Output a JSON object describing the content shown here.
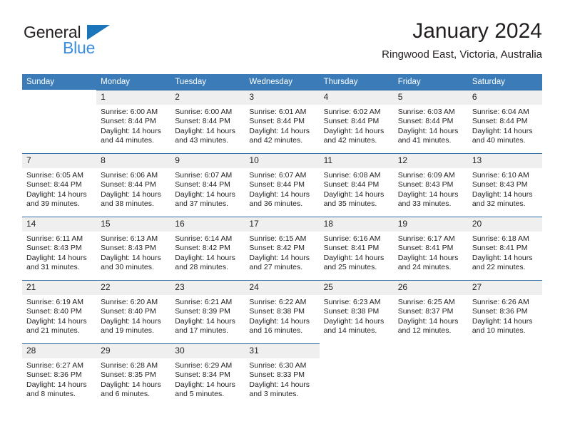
{
  "brand": {
    "name_part1": "General",
    "name_part2": "Blue",
    "triangle_icon": "triangle-icon",
    "accent_dark": "#231f20",
    "accent_blue": "#1b75bb",
    "accent_light_blue": "#3a8dde"
  },
  "header": {
    "month_title": "January 2024",
    "location": "Ringwood East, Victoria, Australia"
  },
  "theme": {
    "header_blue": "#3b7cb8",
    "rule_blue": "#2f6ea5",
    "daynum_bg": "#efefef",
    "text": "#231f20"
  },
  "calendar": {
    "weekday_headers": [
      "Sunday",
      "Monday",
      "Tuesday",
      "Wednesday",
      "Thursday",
      "Friday",
      "Saturday"
    ],
    "weeks": [
      [
        {
          "day": "",
          "empty": true,
          "sunrise": "",
          "sunset": "",
          "daylight1": "",
          "daylight2": ""
        },
        {
          "day": "1",
          "sunrise": "Sunrise: 6:00 AM",
          "sunset": "Sunset: 8:44 PM",
          "daylight1": "Daylight: 14 hours",
          "daylight2": "and 44 minutes."
        },
        {
          "day": "2",
          "sunrise": "Sunrise: 6:00 AM",
          "sunset": "Sunset: 8:44 PM",
          "daylight1": "Daylight: 14 hours",
          "daylight2": "and 43 minutes."
        },
        {
          "day": "3",
          "sunrise": "Sunrise: 6:01 AM",
          "sunset": "Sunset: 8:44 PM",
          "daylight1": "Daylight: 14 hours",
          "daylight2": "and 42 minutes."
        },
        {
          "day": "4",
          "sunrise": "Sunrise: 6:02 AM",
          "sunset": "Sunset: 8:44 PM",
          "daylight1": "Daylight: 14 hours",
          "daylight2": "and 42 minutes."
        },
        {
          "day": "5",
          "sunrise": "Sunrise: 6:03 AM",
          "sunset": "Sunset: 8:44 PM",
          "daylight1": "Daylight: 14 hours",
          "daylight2": "and 41 minutes."
        },
        {
          "day": "6",
          "sunrise": "Sunrise: 6:04 AM",
          "sunset": "Sunset: 8:44 PM",
          "daylight1": "Daylight: 14 hours",
          "daylight2": "and 40 minutes."
        }
      ],
      [
        {
          "day": "7",
          "sunrise": "Sunrise: 6:05 AM",
          "sunset": "Sunset: 8:44 PM",
          "daylight1": "Daylight: 14 hours",
          "daylight2": "and 39 minutes."
        },
        {
          "day": "8",
          "sunrise": "Sunrise: 6:06 AM",
          "sunset": "Sunset: 8:44 PM",
          "daylight1": "Daylight: 14 hours",
          "daylight2": "and 38 minutes."
        },
        {
          "day": "9",
          "sunrise": "Sunrise: 6:07 AM",
          "sunset": "Sunset: 8:44 PM",
          "daylight1": "Daylight: 14 hours",
          "daylight2": "and 37 minutes."
        },
        {
          "day": "10",
          "sunrise": "Sunrise: 6:07 AM",
          "sunset": "Sunset: 8:44 PM",
          "daylight1": "Daylight: 14 hours",
          "daylight2": "and 36 minutes."
        },
        {
          "day": "11",
          "sunrise": "Sunrise: 6:08 AM",
          "sunset": "Sunset: 8:44 PM",
          "daylight1": "Daylight: 14 hours",
          "daylight2": "and 35 minutes."
        },
        {
          "day": "12",
          "sunrise": "Sunrise: 6:09 AM",
          "sunset": "Sunset: 8:43 PM",
          "daylight1": "Daylight: 14 hours",
          "daylight2": "and 33 minutes."
        },
        {
          "day": "13",
          "sunrise": "Sunrise: 6:10 AM",
          "sunset": "Sunset: 8:43 PM",
          "daylight1": "Daylight: 14 hours",
          "daylight2": "and 32 minutes."
        }
      ],
      [
        {
          "day": "14",
          "sunrise": "Sunrise: 6:11 AM",
          "sunset": "Sunset: 8:43 PM",
          "daylight1": "Daylight: 14 hours",
          "daylight2": "and 31 minutes."
        },
        {
          "day": "15",
          "sunrise": "Sunrise: 6:13 AM",
          "sunset": "Sunset: 8:43 PM",
          "daylight1": "Daylight: 14 hours",
          "daylight2": "and 30 minutes."
        },
        {
          "day": "16",
          "sunrise": "Sunrise: 6:14 AM",
          "sunset": "Sunset: 8:42 PM",
          "daylight1": "Daylight: 14 hours",
          "daylight2": "and 28 minutes."
        },
        {
          "day": "17",
          "sunrise": "Sunrise: 6:15 AM",
          "sunset": "Sunset: 8:42 PM",
          "daylight1": "Daylight: 14 hours",
          "daylight2": "and 27 minutes."
        },
        {
          "day": "18",
          "sunrise": "Sunrise: 6:16 AM",
          "sunset": "Sunset: 8:41 PM",
          "daylight1": "Daylight: 14 hours",
          "daylight2": "and 25 minutes."
        },
        {
          "day": "19",
          "sunrise": "Sunrise: 6:17 AM",
          "sunset": "Sunset: 8:41 PM",
          "daylight1": "Daylight: 14 hours",
          "daylight2": "and 24 minutes."
        },
        {
          "day": "20",
          "sunrise": "Sunrise: 6:18 AM",
          "sunset": "Sunset: 8:41 PM",
          "daylight1": "Daylight: 14 hours",
          "daylight2": "and 22 minutes."
        }
      ],
      [
        {
          "day": "21",
          "sunrise": "Sunrise: 6:19 AM",
          "sunset": "Sunset: 8:40 PM",
          "daylight1": "Daylight: 14 hours",
          "daylight2": "and 21 minutes."
        },
        {
          "day": "22",
          "sunrise": "Sunrise: 6:20 AM",
          "sunset": "Sunset: 8:40 PM",
          "daylight1": "Daylight: 14 hours",
          "daylight2": "and 19 minutes."
        },
        {
          "day": "23",
          "sunrise": "Sunrise: 6:21 AM",
          "sunset": "Sunset: 8:39 PM",
          "daylight1": "Daylight: 14 hours",
          "daylight2": "and 17 minutes."
        },
        {
          "day": "24",
          "sunrise": "Sunrise: 6:22 AM",
          "sunset": "Sunset: 8:38 PM",
          "daylight1": "Daylight: 14 hours",
          "daylight2": "and 16 minutes."
        },
        {
          "day": "25",
          "sunrise": "Sunrise: 6:23 AM",
          "sunset": "Sunset: 8:38 PM",
          "daylight1": "Daylight: 14 hours",
          "daylight2": "and 14 minutes."
        },
        {
          "day": "26",
          "sunrise": "Sunrise: 6:25 AM",
          "sunset": "Sunset: 8:37 PM",
          "daylight1": "Daylight: 14 hours",
          "daylight2": "and 12 minutes."
        },
        {
          "day": "27",
          "sunrise": "Sunrise: 6:26 AM",
          "sunset": "Sunset: 8:36 PM",
          "daylight1": "Daylight: 14 hours",
          "daylight2": "and 10 minutes."
        }
      ],
      [
        {
          "day": "28",
          "sunrise": "Sunrise: 6:27 AM",
          "sunset": "Sunset: 8:36 PM",
          "daylight1": "Daylight: 14 hours",
          "daylight2": "and 8 minutes."
        },
        {
          "day": "29",
          "sunrise": "Sunrise: 6:28 AM",
          "sunset": "Sunset: 8:35 PM",
          "daylight1": "Daylight: 14 hours",
          "daylight2": "and 6 minutes."
        },
        {
          "day": "30",
          "sunrise": "Sunrise: 6:29 AM",
          "sunset": "Sunset: 8:34 PM",
          "daylight1": "Daylight: 14 hours",
          "daylight2": "and 5 minutes."
        },
        {
          "day": "31",
          "sunrise": "Sunrise: 6:30 AM",
          "sunset": "Sunset: 8:33 PM",
          "daylight1": "Daylight: 14 hours",
          "daylight2": "and 3 minutes."
        },
        {
          "day": "",
          "empty": true,
          "sunrise": "",
          "sunset": "",
          "daylight1": "",
          "daylight2": ""
        },
        {
          "day": "",
          "empty": true,
          "sunrise": "",
          "sunset": "",
          "daylight1": "",
          "daylight2": ""
        },
        {
          "day": "",
          "empty": true,
          "sunrise": "",
          "sunset": "",
          "daylight1": "",
          "daylight2": ""
        }
      ]
    ]
  }
}
